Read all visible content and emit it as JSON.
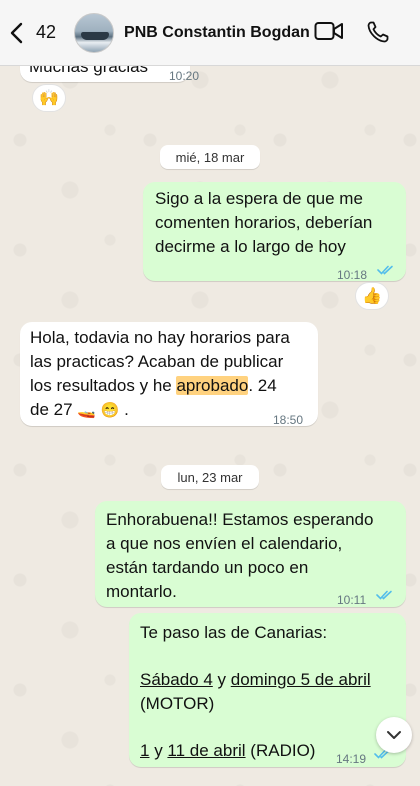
{
  "header": {
    "back_count": "42",
    "contact_name": "PNB Constantin Bogdan"
  },
  "messages": {
    "m1": {
      "text": "Muchas gracias",
      "time": "10:20",
      "reaction": "🙌"
    },
    "date1": "mié, 18 mar",
    "m2": {
      "lines": [
        "Sigo a la espera de que me",
        "comenten horarios, deberían",
        "decirme a lo largo de hoy"
      ],
      "time": "10:18",
      "reaction": "👍"
    },
    "m3": {
      "line1": "Hola, todavia no hay horarios para",
      "line2": "las practicas? Acaban de publicar",
      "line3_pre": "los resultados y he ",
      "line3_hl": "aprobado",
      "line3_post": ". 24",
      "line4": "de 27",
      "emoji1": "🚤",
      "emoji2": "😁",
      "line4_end": " .",
      "time": "18:50"
    },
    "date2": "lun, 23 mar",
    "m4": {
      "lines": [
        "Enhorabuena!! Estamos esperando",
        "a que nos envíen el calendario,",
        "están tardando un poco en",
        "montarlo."
      ],
      "time": "10:11"
    },
    "m5": {
      "line1": "Te paso las de Canarias:",
      "l2_a": "Sábado 4",
      "l2_b": " y ",
      "l2_c": "domingo 5 de abril",
      "line3": "(MOTOR)",
      "l4_a": "1",
      "l4_b": " y ",
      "l4_c": "11 de abril",
      "l4_d": " (RADIO)",
      "time": "14:19"
    }
  },
  "colors": {
    "incoming": "#ffffff",
    "outgoing": "#d9fdd3",
    "read_ticks": "#53bdeb",
    "highlight": "#ffd27f"
  }
}
